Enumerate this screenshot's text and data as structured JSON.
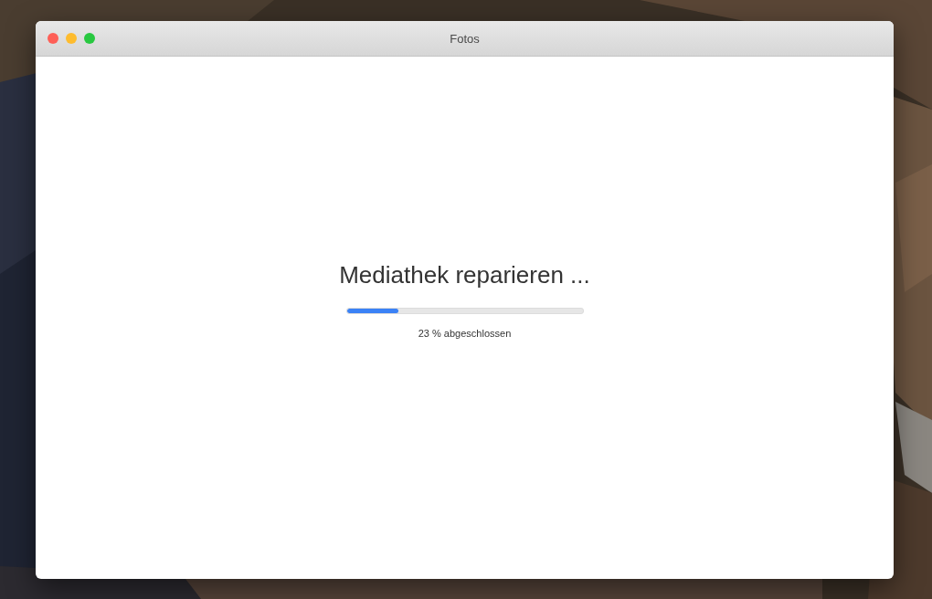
{
  "window": {
    "title": "Fotos"
  },
  "content": {
    "heading": "Mediathek reparieren ...",
    "progress": {
      "level": 0.22,
      "caption": "23 % abgeschlossen"
    }
  }
}
